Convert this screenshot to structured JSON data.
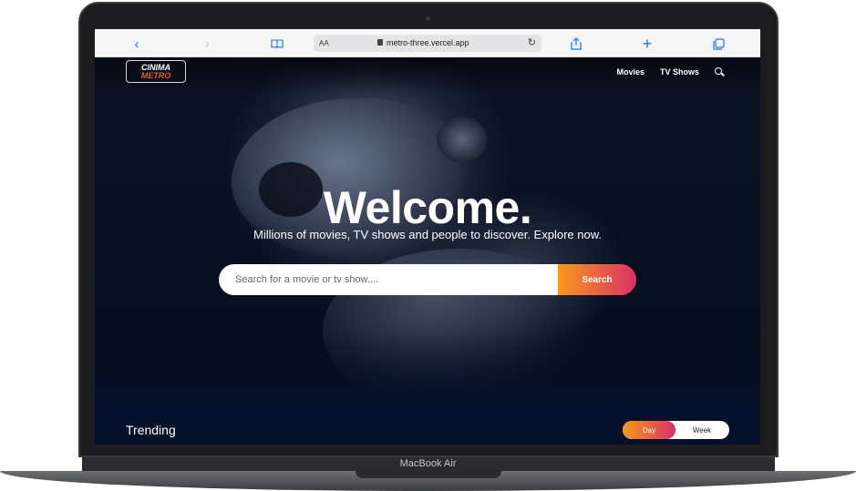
{
  "device": {
    "label": "MacBook Air"
  },
  "browser": {
    "aa_label": "AA",
    "url": "metro-three.vercel.app",
    "icons": {
      "back": "chevron-left-icon",
      "forward": "chevron-right-icon",
      "bookmarks": "book-icon",
      "reload": "reload-icon",
      "share": "share-icon",
      "new_tab": "plus-icon",
      "tabs": "tabs-icon"
    }
  },
  "site": {
    "logo": {
      "line1": "CINIMA",
      "line2": "METRO"
    },
    "nav": {
      "movies": "Movies",
      "tv_shows": "TV Shows"
    },
    "hero": {
      "title": "Welcome.",
      "subtitle": "Millions of movies, TV shows and people to discover. Explore now.",
      "search_placeholder": "Search for a movie or tv show....",
      "search_button": "Search"
    },
    "trending": {
      "title": "Trending",
      "options": [
        "Day",
        "Week"
      ],
      "selected": "Day"
    }
  },
  "colors": {
    "accent_start": "#f89a1c",
    "accent_end": "#da2f68",
    "logo_red": "#f05a28",
    "background": "#04091a",
    "safari_blue": "#1a73e8"
  }
}
